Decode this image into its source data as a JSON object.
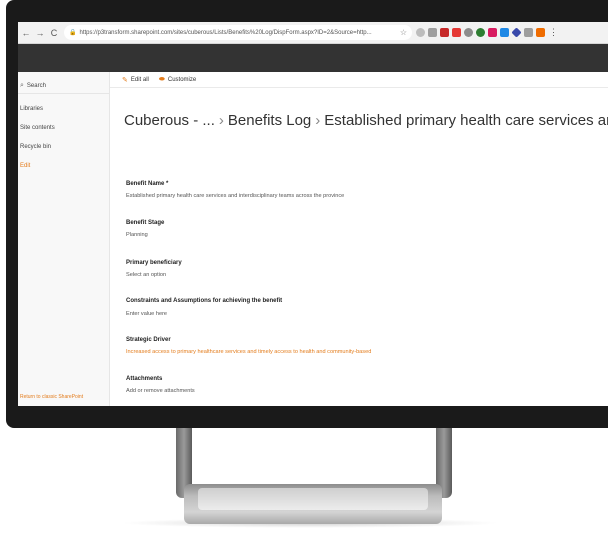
{
  "browser": {
    "url": "https://p3transform.sharepoint.com/sites/cuberous/Lists/Benefits%20Log/DispForm.aspx?ID=2&Source=http...",
    "back_icon": "back-arrow-icon",
    "forward_icon": "forward-arrow-icon",
    "reload_icon": "reload-icon"
  },
  "search": {
    "placeholder": "Search"
  },
  "left_nav": {
    "items": [
      {
        "label": "Libraries"
      },
      {
        "label": "Site contents"
      },
      {
        "label": "Recycle bin"
      },
      {
        "label": "Edit"
      }
    ],
    "return_link": "Return to classic SharePoint"
  },
  "command_bar": {
    "edit_all": "Edit all",
    "customize": "Customize"
  },
  "breadcrumb": {
    "site": "Cuberous - ...",
    "list": "Benefits Log",
    "item": "Established primary health care services and interdiscip"
  },
  "fields": [
    {
      "label": "Benefit Name *",
      "value": "Established primary health care services and interdisciplinary teams across the province"
    },
    {
      "label": "Benefit Stage",
      "value": "Planning"
    },
    {
      "label": "Primary beneficiary",
      "value": "Select an option"
    },
    {
      "label": "Constraints and Assumptions for achieving the benefit",
      "value": "Enter value here"
    },
    {
      "label": "Strategic Driver",
      "value": "Increased access to primary healthcare services and timely access to health and community-based"
    },
    {
      "label": "Attachments",
      "value": "Add or remove attachments"
    }
  ],
  "colors": {
    "accent": "#e37c1c",
    "suite_bar": "#333333"
  }
}
